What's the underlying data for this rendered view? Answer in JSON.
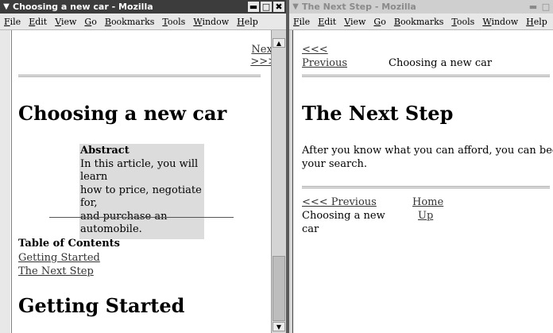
{
  "left_window": {
    "title": "Choosing a new car - Mozilla",
    "menu": [
      "File",
      "Edit",
      "View",
      "Go",
      "Bookmarks",
      "Tools",
      "Window",
      "Help"
    ],
    "nav_next": "Next",
    "nav_next_arrows": ">>>",
    "heading": "Choosing a new car",
    "abstract_title": "Abstract",
    "abstract_lines": [
      "In this article, you will learn",
      "how to price, negotiate for,",
      "and purchase an",
      "automobile."
    ],
    "toc_title": "Table of Contents",
    "toc_items": [
      "Getting Started",
      "The Next Step"
    ],
    "section_heading": "Getting Started"
  },
  "right_window": {
    "title": "The Next Step - Mozilla",
    "menu": [
      "File",
      "Edit",
      "View",
      "Go",
      "Bookmarks",
      "Tools",
      "Window",
      "Help"
    ],
    "nav_prev_arrows": "<<<",
    "nav_prev": "Previous",
    "nav_context": "Choosing a new car",
    "heading": "The Next Step",
    "body_lines": [
      "After you know what you can afford, you can begin",
      "your search."
    ],
    "footer_prev": "<<< Previous",
    "footer_home": "Home",
    "footer_up": "Up",
    "footer_context_lines": [
      "Choosing a new",
      "car"
    ]
  },
  "colors": {
    "active_titlebar": "#3c3c3c",
    "inactive_titlebar": "#cfcfcf",
    "abstract_bg": "#dcdcdc"
  }
}
